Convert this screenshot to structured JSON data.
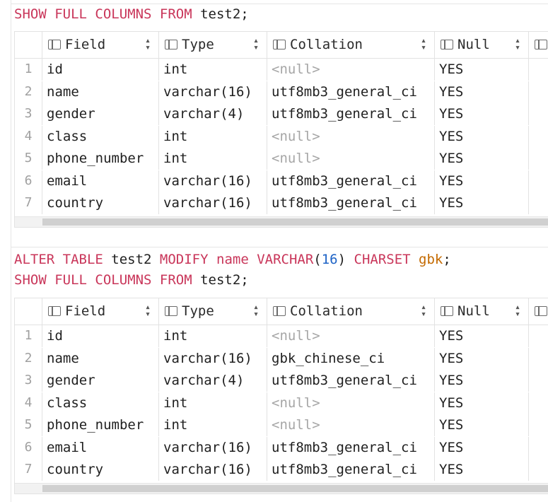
{
  "queries": [
    {
      "tokens": [
        {
          "t": "SHOW FULL COLUMNS FROM ",
          "c": "kw"
        },
        {
          "t": "test2;",
          "c": "plain"
        }
      ]
    },
    {
      "tokens": [
        {
          "t": "ALTER TABLE ",
          "c": "kw"
        },
        {
          "t": "test2 ",
          "c": "plain"
        },
        {
          "t": "MODIFY ",
          "c": "kw"
        },
        {
          "t": "name ",
          "c": "kw"
        },
        {
          "t": "VARCHAR",
          "c": "kw"
        },
        {
          "t": "(",
          "c": "plain"
        },
        {
          "t": "16",
          "c": "num"
        },
        {
          "t": ") ",
          "c": "plain"
        },
        {
          "t": "CHARSET ",
          "c": "kw"
        },
        {
          "t": "gbk",
          "c": "str"
        },
        {
          "t": ";",
          "c": "plain"
        }
      ]
    },
    {
      "tokens": [
        {
          "t": "SHOW FULL COLUMNS FROM ",
          "c": "kw"
        },
        {
          "t": "test2;",
          "c": "plain"
        }
      ]
    }
  ],
  "columns": [
    "Field",
    "Type",
    "Collation",
    "Null"
  ],
  "null_text": "<null>",
  "table1": {
    "rows": [
      {
        "n": "1",
        "field": "id",
        "type": "int",
        "collation": null,
        "null": "YES"
      },
      {
        "n": "2",
        "field": "name",
        "type": "varchar(16)",
        "collation": "utf8mb3_general_ci",
        "null": "YES"
      },
      {
        "n": "3",
        "field": "gender",
        "type": "varchar(4)",
        "collation": "utf8mb3_general_ci",
        "null": "YES"
      },
      {
        "n": "4",
        "field": "class",
        "type": "int",
        "collation": null,
        "null": "YES"
      },
      {
        "n": "5",
        "field": "phone_number",
        "type": "int",
        "collation": null,
        "null": "YES"
      },
      {
        "n": "6",
        "field": "email",
        "type": "varchar(16)",
        "collation": "utf8mb3_general_ci",
        "null": "YES"
      },
      {
        "n": "7",
        "field": "country",
        "type": "varchar(16)",
        "collation": "utf8mb3_general_ci",
        "null": "YES"
      }
    ]
  },
  "table2": {
    "rows": [
      {
        "n": "1",
        "field": "id",
        "type": "int",
        "collation": null,
        "null": "YES"
      },
      {
        "n": "2",
        "field": "name",
        "type": "varchar(16)",
        "collation": "gbk_chinese_ci",
        "null": "YES"
      },
      {
        "n": "3",
        "field": "gender",
        "type": "varchar(4)",
        "collation": "utf8mb3_general_ci",
        "null": "YES"
      },
      {
        "n": "4",
        "field": "class",
        "type": "int",
        "collation": null,
        "null": "YES"
      },
      {
        "n": "5",
        "field": "phone_number",
        "type": "int",
        "collation": null,
        "null": "YES"
      },
      {
        "n": "6",
        "field": "email",
        "type": "varchar(16)",
        "collation": "utf8mb3_general_ci",
        "null": "YES"
      },
      {
        "n": "7",
        "field": "country",
        "type": "varchar(16)",
        "collation": "utf8mb3_general_ci",
        "null": "YES"
      }
    ]
  },
  "icons": {
    "column_icon": "table-column-icon",
    "sort_icon": "sort-icon"
  },
  "colors": {
    "keyword": "#c9365a",
    "number": "#1e63c6",
    "string": "#c46a00",
    "null": "#a6a6a6"
  }
}
